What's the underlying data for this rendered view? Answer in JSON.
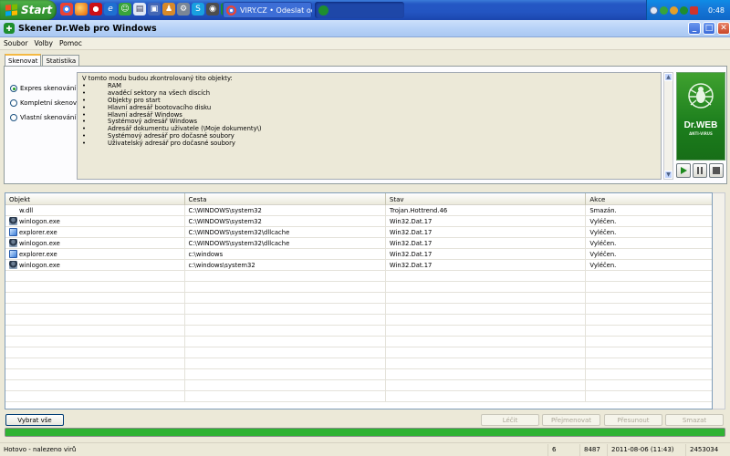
{
  "taskbar": {
    "start_label": "Start",
    "quick_launch": [
      "chrome-icon",
      "firefox-icon",
      "opera-icon",
      "ie-icon",
      "messenger-icon",
      "document-icon",
      "save-icon",
      "people-icon",
      "settings-icon",
      "skype-icon",
      "media-icon",
      "drweb-icon"
    ],
    "tasks": [
      {
        "label": "VIRY.CZ • Odeslat od...",
        "icon": "chrome-icon"
      },
      {
        "label": "",
        "icon": "drweb-icon"
      }
    ],
    "tray_icons": [
      "back-icon",
      "messenger-icon",
      "people-icon",
      "antivirus-icon",
      "security-icon"
    ],
    "clock": "0:48"
  },
  "window": {
    "title": "Skener Dr.Web pro Windows",
    "controls": {
      "minimize": "_",
      "maximize": "□",
      "close": "✕"
    }
  },
  "menu": [
    "Soubor",
    "Volby",
    "Pomoc"
  ],
  "tabs": [
    {
      "label": "Skenovat",
      "active": true
    },
    {
      "label": "Statistika",
      "active": false
    }
  ],
  "scan_modes": [
    {
      "label": "Expres skenování",
      "selected": true
    },
    {
      "label": "Kompletní skenování",
      "selected": false
    },
    {
      "label": "Vlastní skenování",
      "selected": false
    }
  ],
  "objects_info": {
    "intro": "V tomto modu budou zkontrolovaný tito objekty:",
    "bullet": "•",
    "items": [
      "RAM",
      "avaděcí sektory na všech discích",
      "Objekty pro start",
      "Hlavní adresář bootovacího disku",
      "Hlavní adresář Windows",
      "Systémový adresář Windows",
      "Adresář dokumentu uživatele (\\Moje dokumenty\\)",
      "Systémový adresář pro dočasné soubory",
      "Uživatelský adresář pro dočasné soubory"
    ]
  },
  "logo": {
    "brand": "Dr.WEB",
    "subtitle": "ANTI-VIRUS",
    "accent": "#1c7e1d"
  },
  "scan_controls": [
    "play-icon",
    "pause-icon",
    "stop-icon"
  ],
  "results": {
    "columns": [
      "Objekt",
      "Cesta",
      "Stav",
      "Akce"
    ],
    "rows": [
      {
        "icon": "blank",
        "object": "w.dll",
        "path": "C:\\WINDOWS\\system32",
        "status": "Trojan.Hottrend.46",
        "action": "Smazán."
      },
      {
        "icon": "winlogon",
        "object": "winlogon.exe",
        "path": "C:\\WINDOWS\\system32",
        "status": "Win32.Dat.17",
        "action": "Vyléčen."
      },
      {
        "icon": "explorer",
        "object": "explorer.exe",
        "path": "C:\\WINDOWS\\system32\\dllcache",
        "status": "Win32.Dat.17",
        "action": "Vyléčen."
      },
      {
        "icon": "winlogon",
        "object": "winlogon.exe",
        "path": "C:\\WINDOWS\\system32\\dllcache",
        "status": "Win32.Dat.17",
        "action": "Vyléčen."
      },
      {
        "icon": "explorer",
        "object": "explorer.exe",
        "path": "c:\\windows",
        "status": "Win32.Dat.17",
        "action": "Vyléčen."
      },
      {
        "icon": "winlogon",
        "object": "winlogon.exe",
        "path": "c:\\windows\\system32",
        "status": "Win32.Dat.17",
        "action": "Vyléčen."
      }
    ]
  },
  "buttons": {
    "select_all": "Vybrat vše",
    "cure": "Léčit",
    "rename": "Přejmenovat",
    "move": "Přesunout",
    "delete": "Smazat"
  },
  "progress": 1.0,
  "progress_color": "#2fb232",
  "status": {
    "message": "Hotovo - nalezeno virů",
    "count": "6",
    "records": "8487",
    "datetime": "2011-08-06 (11:43)",
    "number": "2453034"
  }
}
